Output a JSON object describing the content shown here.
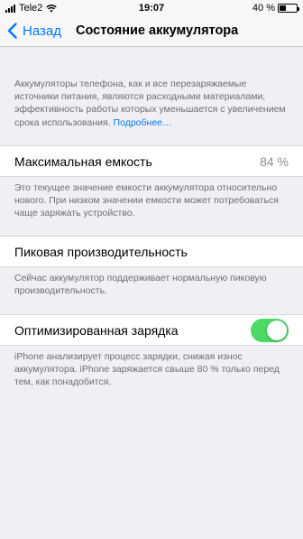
{
  "status_bar": {
    "carrier": "Tele2",
    "time": "19:07",
    "battery_percent_text": "40 %",
    "battery_level": 0.4
  },
  "nav": {
    "back_label": "Назад",
    "title": "Состояние аккумулятора"
  },
  "intro": {
    "text": "Аккумуляторы телефона, как и все перезаряжаемые источники питания, являются расходными материалами, эффективность работы которых уменьшается с увеличением срока использования.",
    "link": "Подробнее…"
  },
  "max_capacity": {
    "label": "Максимальная емкость",
    "value": "84 %",
    "footer": "Это текущее значение емкости аккумулятора относительно нового. При низком значении емкости может потребоваться чаще заряжать устройство."
  },
  "peak_performance": {
    "label": "Пиковая производительность",
    "footer": "Сейчас аккумулятор поддерживает нормальную пиковую производительность."
  },
  "optimized_charging": {
    "label": "Оптимизированная зарядка",
    "enabled": true,
    "toggle_color": "#4cd964",
    "footer": "iPhone анализирует процесс зарядки, снижая износ аккумулятора. iPhone заряжается свыше 80 % только перед тем, как понадобится."
  }
}
